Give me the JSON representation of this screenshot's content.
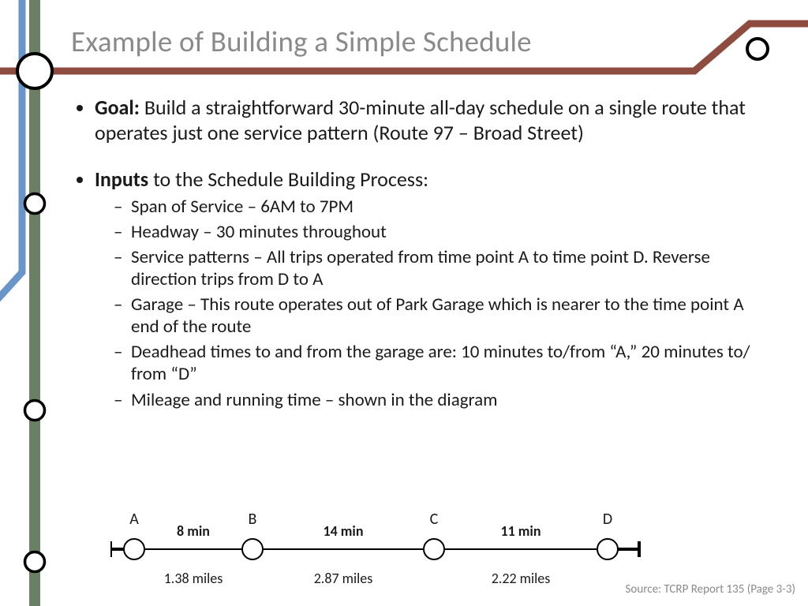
{
  "title": "Example of Building a Simple Schedule",
  "bullets": {
    "goal": {
      "label": "Goal:",
      "text": " Build a straightforward 30-minute all-day schedule on a single route that operates just one service pattern (Route 97 – Broad Street)"
    },
    "inputs": {
      "label": "Inputs",
      "text": " to the Schedule Building Process:",
      "items": [
        "Span of Service – 6AM to 7PM",
        "Headway – 30 minutes throughout",
        "Service patterns – All trips operated from time point A to time point D. Reverse direction trips from D to A",
        "Garage – This route operates out of Park Garage which is nearer to the time point A end of the route",
        "Deadhead times to and from the garage are: 10 minutes to/from “A,” 20 minutes to/ from “D”",
        "Mileage and running time – shown in the diagram"
      ]
    }
  },
  "diagram": {
    "nodes": [
      "A",
      "B",
      "C",
      "D"
    ],
    "segments": [
      {
        "time": "8 min",
        "miles": "1.38 miles"
      },
      {
        "time": "14 min",
        "miles": "2.87 miles"
      },
      {
        "time": "11 min",
        "miles": "2.22 miles"
      }
    ]
  },
  "source": "Source: TCRP Report 135 (Page 3-3)",
  "colors": {
    "blue": "#6a95c7",
    "green": "#6a7f63",
    "brown": "#8e4b3f"
  }
}
